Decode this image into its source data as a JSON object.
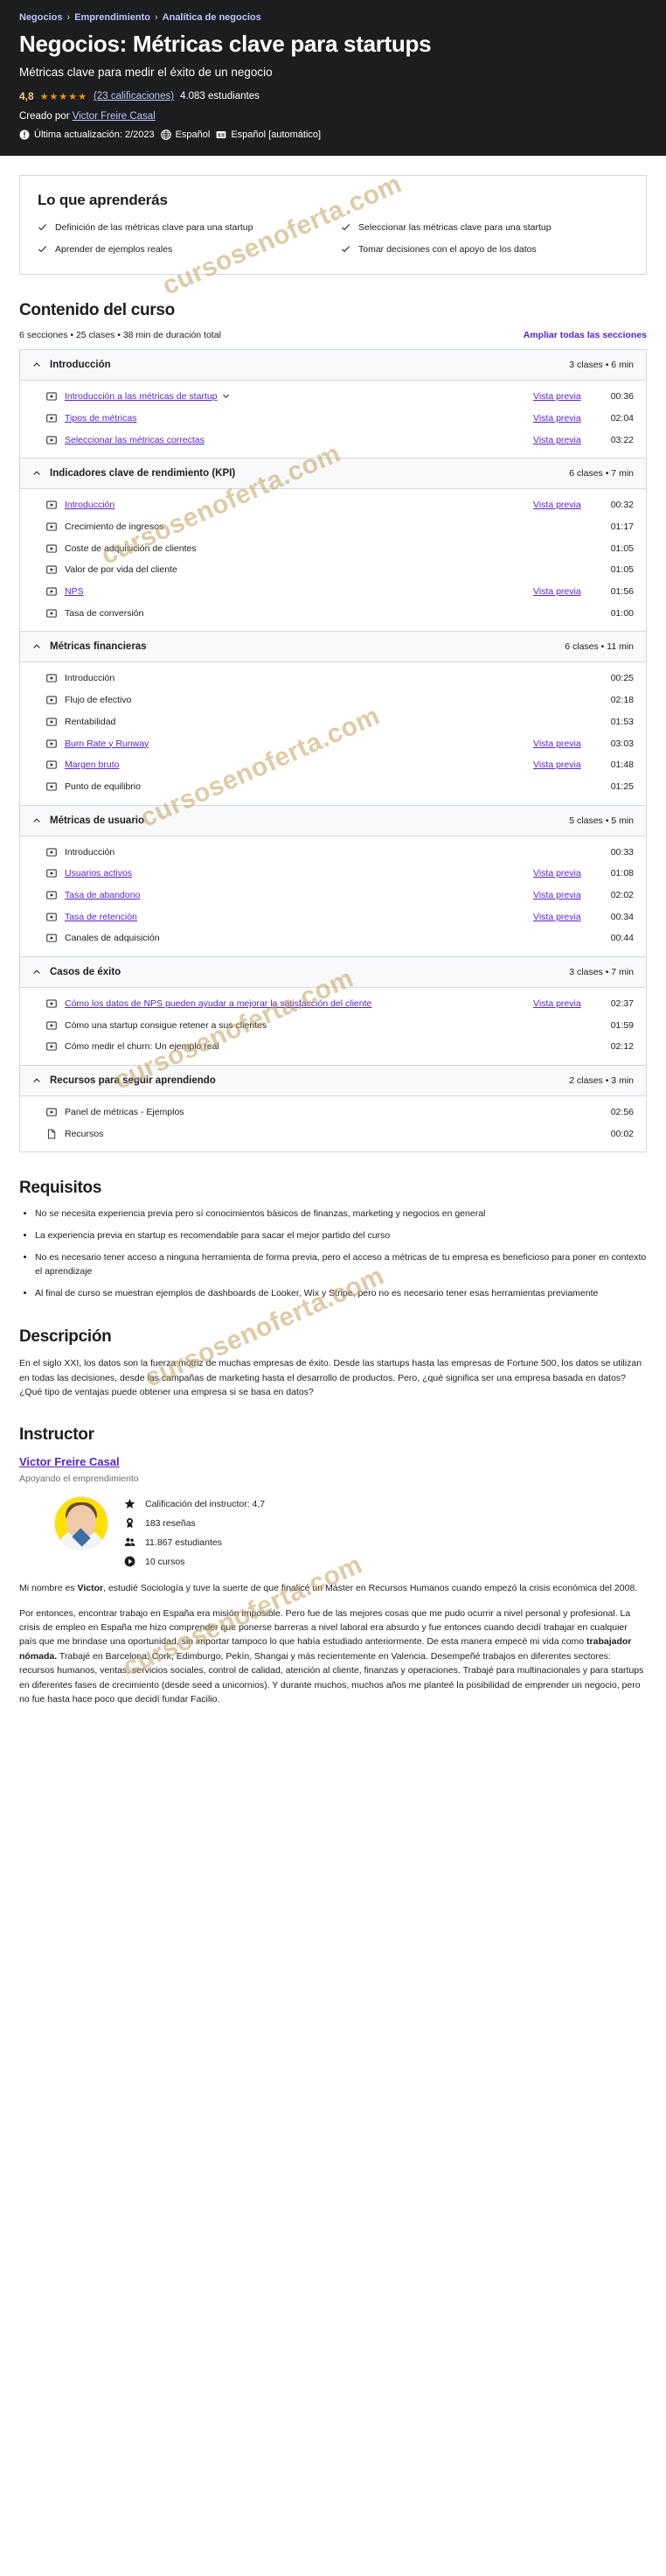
{
  "breadcrumb": [
    "Negocios",
    "Emprendimiento",
    "Analítica de negocios"
  ],
  "hero": {
    "title": "Negocios: Métricas clave para startups",
    "subtitle": "Métricas clave para medir el éxito de un negocio",
    "rating_value": "4,8",
    "stars": "★★★★★",
    "ratings_link": "(23 calificaciones)",
    "students": "4.083 estudiantes",
    "created_by_label": "Creado por",
    "author": "Victor Freire Casal",
    "last_update": "Última actualización: 2/2023",
    "language": "Español",
    "captions": "Español [automático]"
  },
  "learn": {
    "heading": "Lo que aprenderás",
    "items": [
      "Definición de las métricas clave para una startup",
      "Seleccionar las métricas clave para una startup",
      "Aprender de ejemplos reales",
      "Tomar decisiones con el apoyo de los datos"
    ]
  },
  "curriculum": {
    "heading": "Contenido del curso",
    "summary": "6 secciones • 25 clases • 38 min de duración total",
    "expand_label": "Ampliar todas las secciones",
    "preview_label": "Vista previa",
    "sections": [
      {
        "title": "Introducción",
        "meta": "3 clases • 6 min",
        "lessons": [
          {
            "title": "Introducción a las métricas de startup",
            "link": true,
            "caret": true,
            "preview": "Vista previa",
            "duration": "00:36",
            "icon": "video"
          },
          {
            "title": "Tipos de métricas",
            "link": true,
            "caret": false,
            "preview": "Vista previa",
            "duration": "02:04",
            "icon": "video"
          },
          {
            "title": "Seleccionar las métricas correctas",
            "link": true,
            "caret": false,
            "preview": "Vista previa",
            "duration": "03:22",
            "icon": "video"
          }
        ]
      },
      {
        "title": "Indicadores clave de rendimiento (KPI)",
        "meta": "6 clases • 7 min",
        "lessons": [
          {
            "title": "Introducción",
            "link": true,
            "caret": false,
            "preview": "Vista previa",
            "duration": "00:32",
            "icon": "video"
          },
          {
            "title": "Crecimiento de ingresos",
            "link": false,
            "caret": false,
            "preview": "",
            "duration": "01:17",
            "icon": "video"
          },
          {
            "title": "Coste de adquisición de clientes",
            "link": false,
            "caret": false,
            "preview": "",
            "duration": "01:05",
            "icon": "video"
          },
          {
            "title": "Valor de por vida del cliente",
            "link": false,
            "caret": false,
            "preview": "",
            "duration": "01:05",
            "icon": "video"
          },
          {
            "title": "NPS",
            "link": true,
            "caret": false,
            "preview": "Vista previa",
            "duration": "01:56",
            "icon": "video"
          },
          {
            "title": "Tasa de conversión",
            "link": false,
            "caret": false,
            "preview": "",
            "duration": "01:00",
            "icon": "video"
          }
        ]
      },
      {
        "title": "Métricas financieras",
        "meta": "6 clases • 11 min",
        "lessons": [
          {
            "title": "Introducción",
            "link": false,
            "caret": false,
            "preview": "",
            "duration": "00:25",
            "icon": "video"
          },
          {
            "title": "Flujo de efectivo",
            "link": false,
            "caret": false,
            "preview": "",
            "duration": "02:18",
            "icon": "video"
          },
          {
            "title": "Rentabilidad",
            "link": false,
            "caret": false,
            "preview": "",
            "duration": "01:53",
            "icon": "video"
          },
          {
            "title": "Burn Rate y Runway",
            "link": true,
            "caret": false,
            "preview": "Vista previa",
            "duration": "03:03",
            "icon": "video"
          },
          {
            "title": "Margen bruto",
            "link": true,
            "caret": false,
            "preview": "Vista previa",
            "duration": "01:48",
            "icon": "video"
          },
          {
            "title": "Punto de equilibrio",
            "link": false,
            "caret": false,
            "preview": "",
            "duration": "01:25",
            "icon": "video"
          }
        ]
      },
      {
        "title": "Métricas de usuario",
        "meta": "5 clases • 5 min",
        "lessons": [
          {
            "title": "Introducción",
            "link": false,
            "caret": false,
            "preview": "",
            "duration": "00:33",
            "icon": "video"
          },
          {
            "title": "Usuarios activos",
            "link": true,
            "caret": false,
            "preview": "Vista previa",
            "duration": "01:08",
            "icon": "video"
          },
          {
            "title": "Tasa de abandono",
            "link": true,
            "caret": false,
            "preview": "Vista previa",
            "duration": "02:02",
            "icon": "video"
          },
          {
            "title": "Tasa de retención",
            "link": true,
            "caret": false,
            "preview": "Vista previa",
            "duration": "00:34",
            "icon": "video"
          },
          {
            "title": "Canales de adquisición",
            "link": false,
            "caret": false,
            "preview": "",
            "duration": "00:44",
            "icon": "video"
          }
        ]
      },
      {
        "title": "Casos de éxito",
        "meta": "3 clases • 7 min",
        "lessons": [
          {
            "title": "Cómo los datos de NPS pueden ayudar a mejorar la satisfacción del cliente",
            "link": true,
            "caret": false,
            "preview": "Vista previa",
            "duration": "02:37",
            "icon": "video"
          },
          {
            "title": "Cómo una startup consigue retener a sus clientes",
            "link": false,
            "caret": false,
            "preview": "",
            "duration": "01:59",
            "icon": "video"
          },
          {
            "title": "Cómo medir el churn: Un ejemplo real",
            "link": false,
            "caret": false,
            "preview": "",
            "duration": "02:12",
            "icon": "video"
          }
        ]
      },
      {
        "title": "Recursos para seguir aprendiendo",
        "meta": "2 clases • 3 min",
        "lessons": [
          {
            "title": "Panel de métricas - Ejemplos",
            "link": false,
            "caret": false,
            "preview": "",
            "duration": "02:56",
            "icon": "video"
          },
          {
            "title": "Recursos",
            "link": false,
            "caret": false,
            "preview": "",
            "duration": "00:02",
            "icon": "doc"
          }
        ]
      }
    ]
  },
  "requirements": {
    "heading": "Requisitos",
    "items": [
      "No se necesita experiencia previa pero sí conocimientos básicos de finanzas, marketing y negocios en general",
      "La experiencia previa en startup es recomendable para sacar el mejor partido del curso",
      "No es necesario tener acceso a ninguna herramienta de forma previa, pero el acceso a métricas de tu empresa es beneficioso para poner en contexto el aprendizaje",
      "Al final de curso se muestran ejemplos de dashboards de Looker, Wix y Stripe, pero no es necesario tener esas herramientas previamente"
    ]
  },
  "description": {
    "heading": "Descripción",
    "paragraph": "En el siglo XXI, los datos son la fuerza motriz de muchas empresas de éxito. Desde las startups hasta las empresas de Fortune 500, los datos se utilizan en todas las decisiones, desde las campañas de marketing hasta el desarrollo de productos. Pero, ¿qué significa ser una empresa basada en datos? ¿Qué tipo de ventajas puede obtener una empresa si se basa en datos?"
  },
  "instructor": {
    "heading": "Instructor",
    "name": "Victor Freire Casal",
    "tagline": "Apoyando el emprendimiento",
    "stats": [
      {
        "icon": "star-icon",
        "text": "Calificación del instructor: 4,7"
      },
      {
        "icon": "award-icon",
        "text": "183 reseñas"
      },
      {
        "icon": "users-icon",
        "text": "11.867 estudiantes"
      },
      {
        "icon": "play-circle-icon",
        "text": "10 cursos"
      }
    ],
    "bio": [
      "Mi nombre es <b>Victor</b>, estudié Sociología y tuve la suerte de que finalicé un Máster en Recursos Humanos cuando empezó la crisis económica del 2008.",
      "Por entonces, encontrar trabajo en España era misión imposible. Pero fue de las mejores cosas que me pudo ocurrir a nivel personal y profesional. La crisis de empleo en España me hizo comprender que ponerse barreras a nivel laboral era absurdo y fue entonces cuando decidí trabajar en cualquier país que me brindase una oportunidad, sin importar tampoco lo que había estudiado anteriormente. De esta manera empecé mi vida como <b>trabajador nómada.</b> Trabajé en Barcelona, Cork, Edimburgo, Pekín, Shangai y más recientemente en Valencia. Desempeñé trabajos en diferentes sectores: recursos humanos, ventas, servicios sociales, control de calidad, atención al cliente, finanzas y operaciones. Trabajé para multinacionales y para startups en diferentes fases de crecimiento (desde seed a unicornios). Y durante muchos, muchos años me planteé la posibilidad de emprender un negocio, pero no fue hasta hace poco que decidí fundar Facilio."
    ]
  },
  "watermark": {
    "text": "cursosenoferta.com"
  },
  "colors": {
    "hero_bg": "#1c1d1f",
    "link_purple": "#5624d0",
    "hero_link": "#c0c4fc",
    "star": "#e59819",
    "border": "#d1d7dc"
  }
}
